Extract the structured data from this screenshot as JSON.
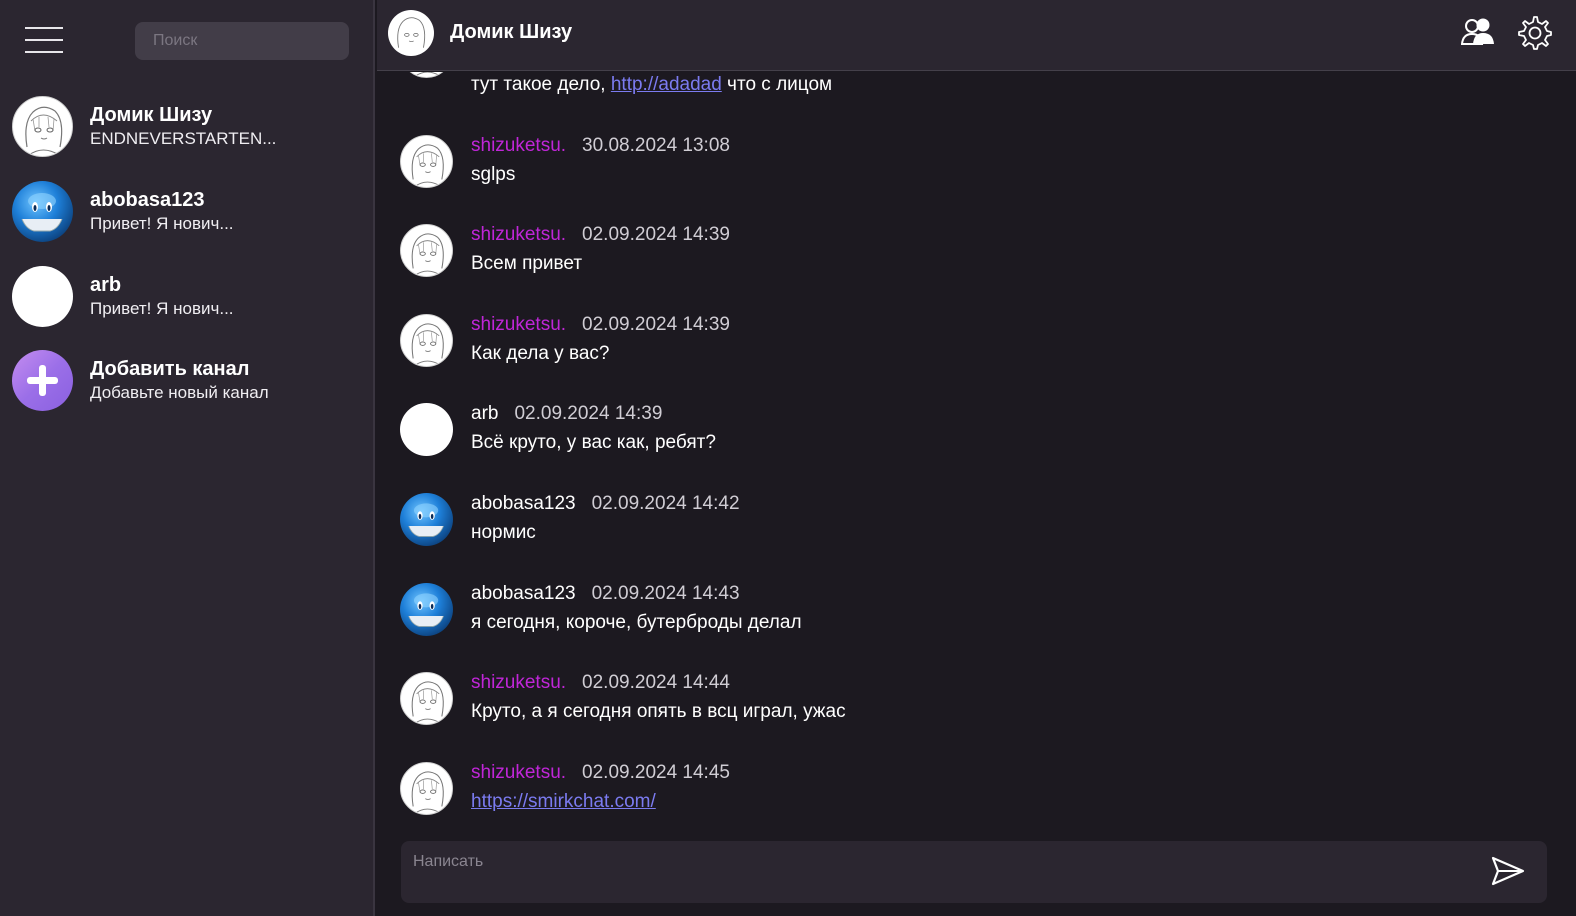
{
  "sidebar": {
    "search_placeholder": "Поиск",
    "channels": [
      {
        "name": "Домик Шизу",
        "preview": "ENDNEVERSTARTEN...",
        "avatar": "girl-sketch"
      },
      {
        "name": "abobasa123",
        "preview": "Привет! Я нович...",
        "avatar": "blue-ball"
      },
      {
        "name": "arb",
        "preview": "Привет! Я нович...",
        "avatar": "blank-white"
      },
      {
        "name": "Добавить канал",
        "preview": "Добавьте новый канал",
        "avatar": "plus-icon"
      }
    ]
  },
  "header": {
    "title": "Домик Шизу",
    "users_icon": "users-icon",
    "settings_icon": "gear-icon"
  },
  "messages": [
    {
      "author": "",
      "time": "",
      "text_before": "тут такое дело, ",
      "link": "http://adadad",
      "text_after": " что с лицом",
      "avatar": "girl-sketch"
    },
    {
      "author": "shizuketsu.",
      "time": "30.08.2024 13:08",
      "text": "sglps",
      "avatar": "girl-sketch"
    },
    {
      "author": "shizuketsu.",
      "time": "02.09.2024 14:39",
      "text": "Всем привет",
      "avatar": "girl-sketch"
    },
    {
      "author": "shizuketsu.",
      "time": "02.09.2024 14:39",
      "text": "Как дела у вас?",
      "avatar": "girl-sketch"
    },
    {
      "author": "arb",
      "time": "02.09.2024 14:39",
      "text": "Всё круто, у вас как, ребят?",
      "avatar": "blank-white"
    },
    {
      "author": "abobasa123",
      "time": "02.09.2024 14:42",
      "text": "нормис",
      "avatar": "blue-ball"
    },
    {
      "author": "abobasa123",
      "time": "02.09.2024 14:43",
      "text": "я сегодня, короче, бутерброды делал",
      "avatar": "blue-ball"
    },
    {
      "author": "shizuketsu.",
      "time": "02.09.2024 14:44",
      "text": "Круто, а я сегодня опять в всц играл, ужас",
      "avatar": "girl-sketch"
    },
    {
      "author": "shizuketsu.",
      "time": "02.09.2024 14:45",
      "link": "https://smirkchat.com/",
      "avatar": "girl-sketch"
    }
  ],
  "composer": {
    "placeholder": "Написать",
    "send_icon": "send-icon"
  },
  "colors": {
    "sidebar_bg": "#2b2630",
    "main_bg": "#1c1920",
    "accent_author": "#c026d8",
    "link": "#7b7bf0"
  }
}
